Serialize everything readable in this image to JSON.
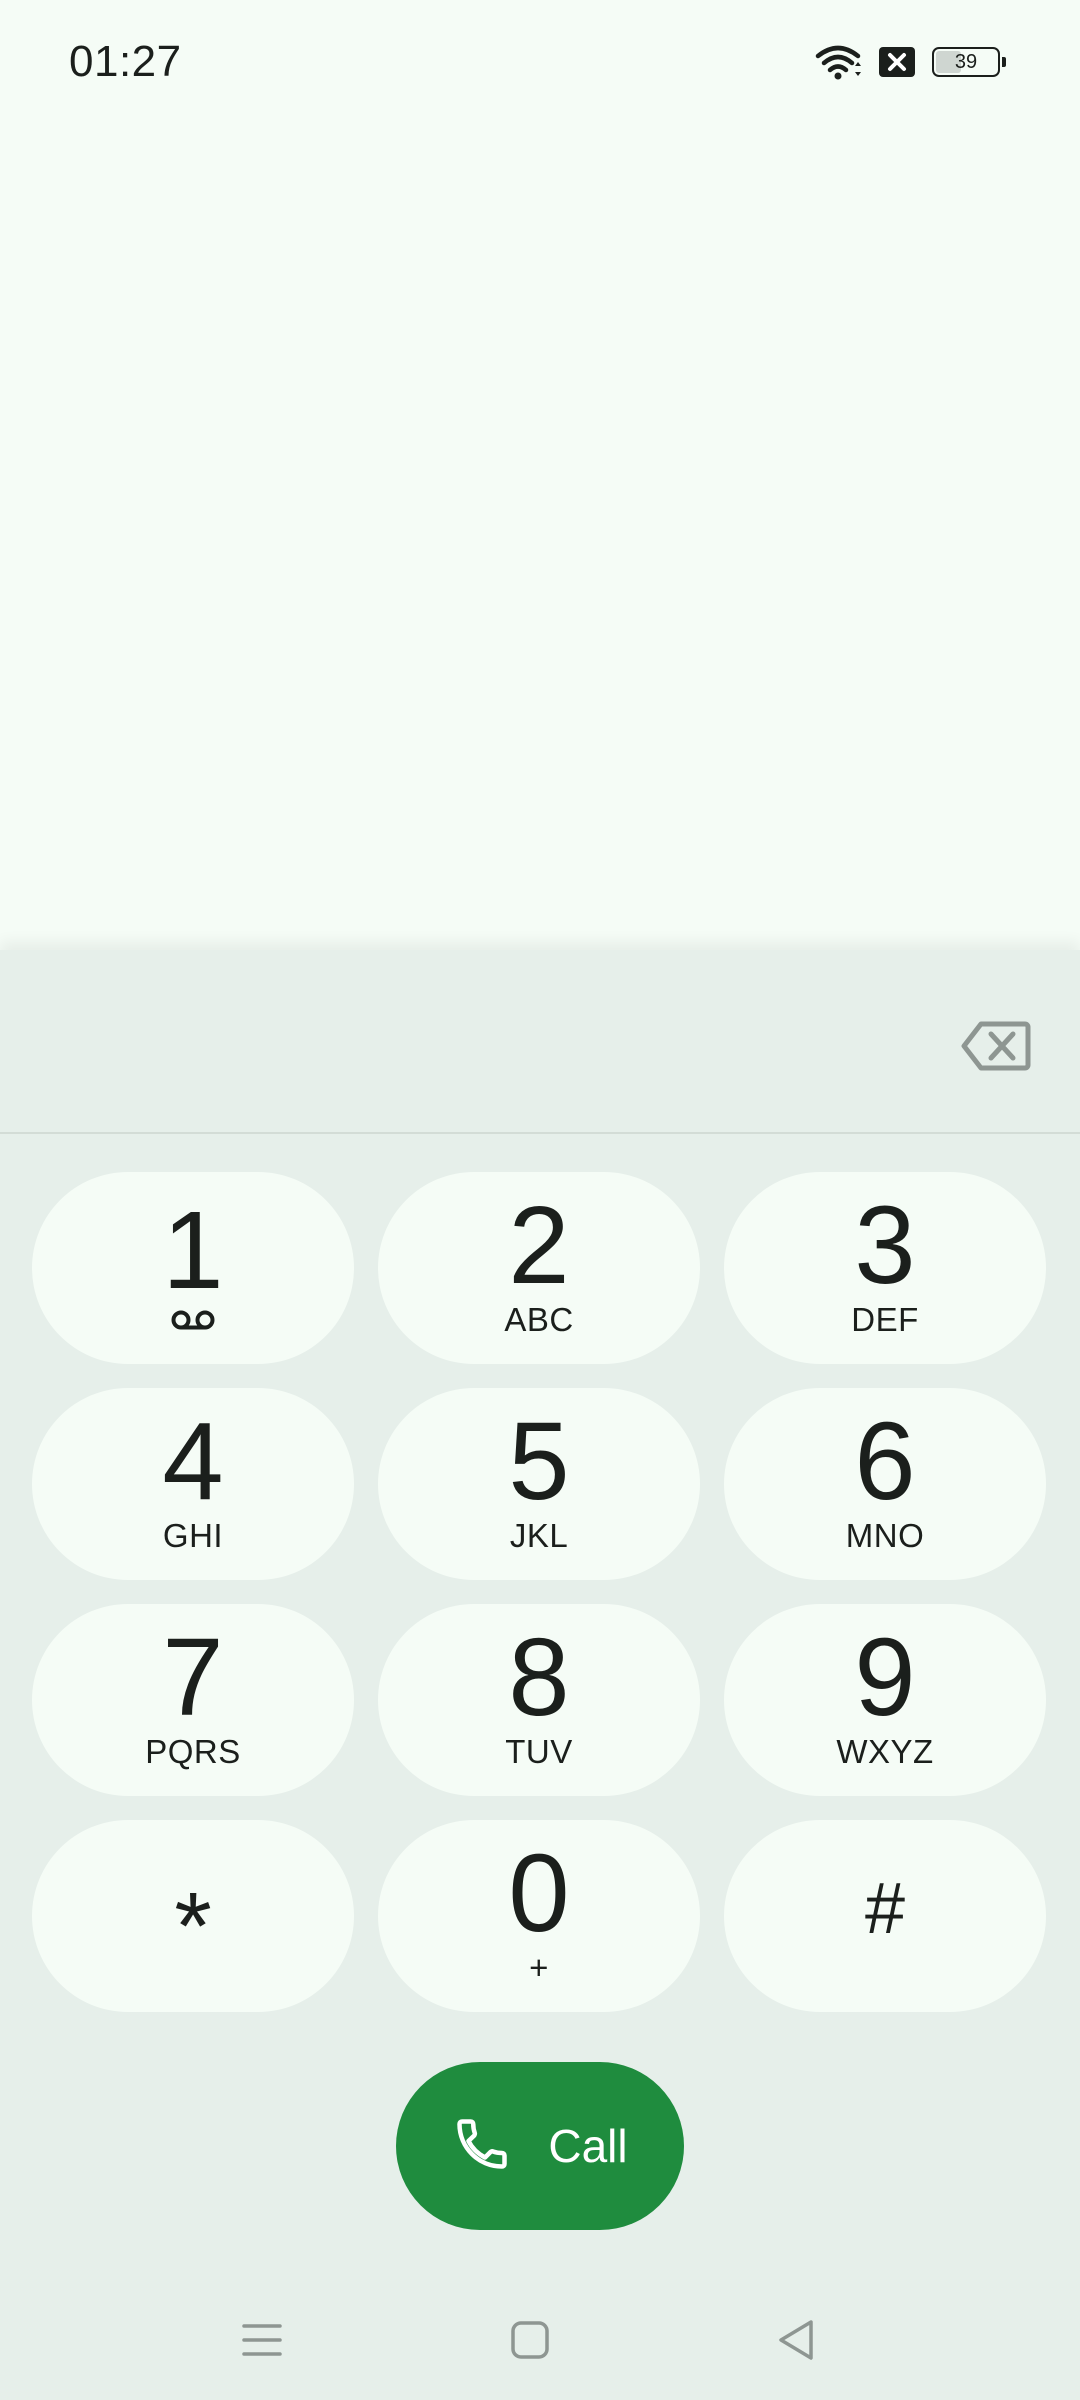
{
  "status_bar": {
    "time": "01:27",
    "battery_level": "39",
    "icons": [
      "wifi-icon",
      "no-sim-icon",
      "battery-icon"
    ]
  },
  "dialpad": {
    "digits": "",
    "keys": [
      {
        "digit": "1",
        "letters": "",
        "icon": "voicemail-icon"
      },
      {
        "digit": "2",
        "letters": "ABC"
      },
      {
        "digit": "3",
        "letters": "DEF"
      },
      {
        "digit": "4",
        "letters": "GHI"
      },
      {
        "digit": "5",
        "letters": "JKL"
      },
      {
        "digit": "6",
        "letters": "MNO"
      },
      {
        "digit": "7",
        "letters": "PQRS"
      },
      {
        "digit": "8",
        "letters": "TUV"
      },
      {
        "digit": "9",
        "letters": "WXYZ"
      },
      {
        "digit": "*",
        "letters": ""
      },
      {
        "digit": "0",
        "letters": "+"
      },
      {
        "digit": "#",
        "letters": ""
      }
    ],
    "call_label": "Call"
  },
  "colors": {
    "background": "#f5fcf6",
    "sheet": "#e6efea",
    "key": "#f5fcf6",
    "call_button": "#1f8c3e"
  },
  "nav_bar": {
    "buttons": [
      "recents-menu-icon",
      "home-icon",
      "back-icon"
    ]
  }
}
